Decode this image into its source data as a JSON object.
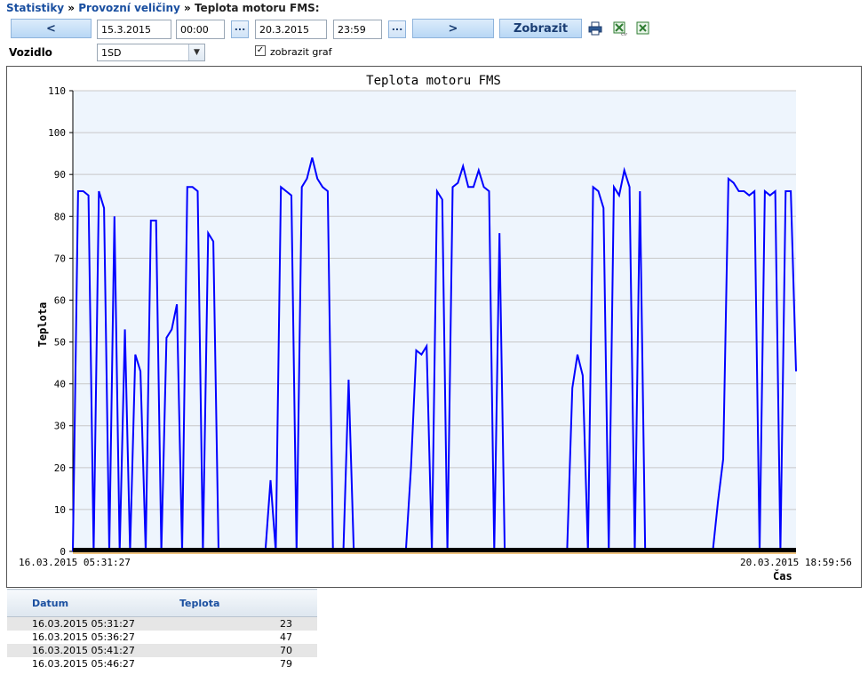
{
  "breadcrumb": {
    "root": "Statistiky",
    "sep": " » ",
    "mid": "Provozní veličiny",
    "current": "Teplota motoru FMS:"
  },
  "toolbar": {
    "prev_label": "<",
    "date_from": "15.3.2015",
    "time_from": "00:00",
    "dots": "...",
    "date_to": "20.3.2015",
    "time_to": "23:59",
    "next_label": ">",
    "show_label": "Zobrazit",
    "icons": [
      "print-icon",
      "csv-export-icon",
      "excel-export-icon"
    ]
  },
  "vehicle": {
    "label": "Vozidlo",
    "value": "1SD",
    "show_graph_checked": true,
    "show_graph_label": "zobrazit graf"
  },
  "colors": {
    "series": "#0000ff",
    "plot_bg": "#eef5fd",
    "grid": "#c8c8c8",
    "link": "#1a4fa0"
  },
  "chart_data": {
    "type": "line",
    "title": "Teplota motoru FMS",
    "ylabel": "Teplota",
    "xlabel": "Čas",
    "ylim": [
      0,
      110
    ],
    "yticks": [
      0,
      10,
      20,
      30,
      40,
      50,
      60,
      70,
      80,
      90,
      100,
      110
    ],
    "x_start": "16.03.2015 05:31:27",
    "x_end": "20.03.2015 18:59:56",
    "grid": true,
    "series": [
      {
        "values": [
          0,
          86,
          86,
          85,
          0,
          86,
          82,
          0,
          80,
          0,
          53,
          0,
          47,
          43,
          0,
          79,
          79,
          0,
          51,
          53,
          59,
          0,
          87,
          87,
          86,
          0,
          76,
          74,
          0,
          0,
          0,
          0,
          0,
          0,
          0,
          0,
          0,
          0,
          17,
          0,
          87,
          86,
          85,
          0,
          87,
          89,
          94,
          89,
          87,
          86,
          0,
          0,
          0,
          41,
          0,
          0,
          0,
          0,
          0,
          0,
          0,
          0,
          0,
          0,
          0,
          20,
          48,
          47,
          49,
          0,
          86,
          84,
          0,
          87,
          88,
          92,
          87,
          87,
          91,
          87,
          86,
          0,
          76,
          0,
          0,
          0,
          0,
          0,
          0,
          0,
          0,
          0,
          0,
          0,
          0,
          0,
          39,
          47,
          42,
          0,
          87,
          86,
          82,
          0,
          87,
          85,
          91,
          87,
          0,
          86,
          0,
          0,
          0,
          0,
          0,
          0,
          0,
          0,
          0,
          0,
          0,
          0,
          0,
          0,
          12,
          22,
          89,
          88,
          86,
          86,
          85,
          86,
          0,
          86,
          85,
          86,
          0,
          86,
          86,
          43
        ]
      }
    ]
  },
  "table": {
    "headers": [
      "Datum",
      "Teplota"
    ],
    "rows": [
      [
        "16.03.2015 05:31:27",
        "23"
      ],
      [
        "16.03.2015 05:36:27",
        "47"
      ],
      [
        "16.03.2015 05:41:27",
        "70"
      ],
      [
        "16.03.2015 05:46:27",
        "79"
      ]
    ]
  }
}
